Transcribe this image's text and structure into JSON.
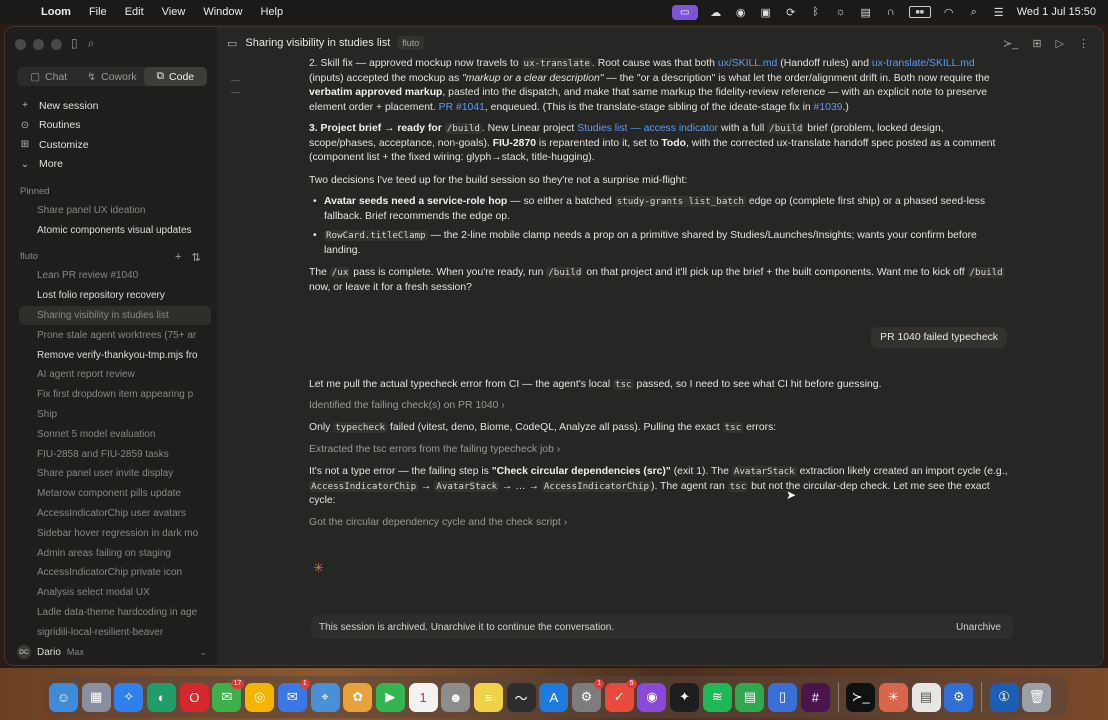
{
  "menubar": {
    "app_name": "Loom",
    "menus": [
      "File",
      "Edit",
      "View",
      "Window",
      "Help"
    ],
    "clock": "Wed 1 Jul  15:50"
  },
  "sidebar": {
    "tabs": [
      {
        "label": "Chat",
        "icon": "chat-icon"
      },
      {
        "label": "Cowork",
        "icon": "cowork-icon"
      },
      {
        "label": "Code",
        "icon": "code-icon",
        "active": true
      }
    ],
    "nav": [
      {
        "label": "New session",
        "icon": "plus-icon"
      },
      {
        "label": "Routines",
        "icon": "routines-icon"
      },
      {
        "label": "Customize",
        "icon": "customize-icon"
      },
      {
        "label": "More",
        "icon": "chevron-down-icon"
      }
    ],
    "pinned_label": "Pinned",
    "pinned": [
      {
        "title": "Share panel UX ideation"
      },
      {
        "title": "Atomic components visual updates"
      }
    ],
    "project_label": "fluto",
    "sessions": [
      {
        "title": "Lean PR review #1040"
      },
      {
        "title": "Lost folio repository recovery"
      },
      {
        "title": "Sharing visibility in studies list"
      },
      {
        "title": "Prone stale agent worktrees (75+ ar"
      },
      {
        "title": "Remove verify-thankyou-tmp.mjs fro"
      },
      {
        "title": "AI agent report review"
      },
      {
        "title": "Fix first dropdown item appearing p"
      },
      {
        "title": "Ship"
      },
      {
        "title": "Sonnet 5 model evaluation"
      },
      {
        "title": "FIU-2858 and FIU-2859 tasks"
      },
      {
        "title": "Share panel user invite display"
      },
      {
        "title": "Metarow component pills update"
      },
      {
        "title": "AccessIndicatorChip user avatars"
      },
      {
        "title": "Sidebar hover regression in dark mo"
      },
      {
        "title": "Admin areas failing on staging"
      },
      {
        "title": "AccessIndicatorChip private icon"
      },
      {
        "title": "Analysis select modal UX"
      },
      {
        "title": "Ladle data-theme hardcoding in age"
      },
      {
        "title": "sigridili-local-resilient-beaver"
      }
    ],
    "user": {
      "initials": "DC",
      "name": "Dario",
      "plan": "Max"
    }
  },
  "header": {
    "title": "Sharing visibility in studies list",
    "badge": "fluto"
  },
  "conversation": {
    "user_message": "PR 1040 failed typecheck",
    "steps": [
      "Identified the failing check(s) on PR 1040",
      "Extracted the tsc errors from the failing typecheck job",
      "Got the circular dependency cycle and the check script"
    ],
    "archived_text": "This session is archived. Unarchive it to continue the conversation.",
    "unarchive_label": "Unarchive"
  },
  "colors": {
    "accent": "#e86a4c",
    "link": "#5b9cf0",
    "selected_tab": "#3d3c39"
  }
}
